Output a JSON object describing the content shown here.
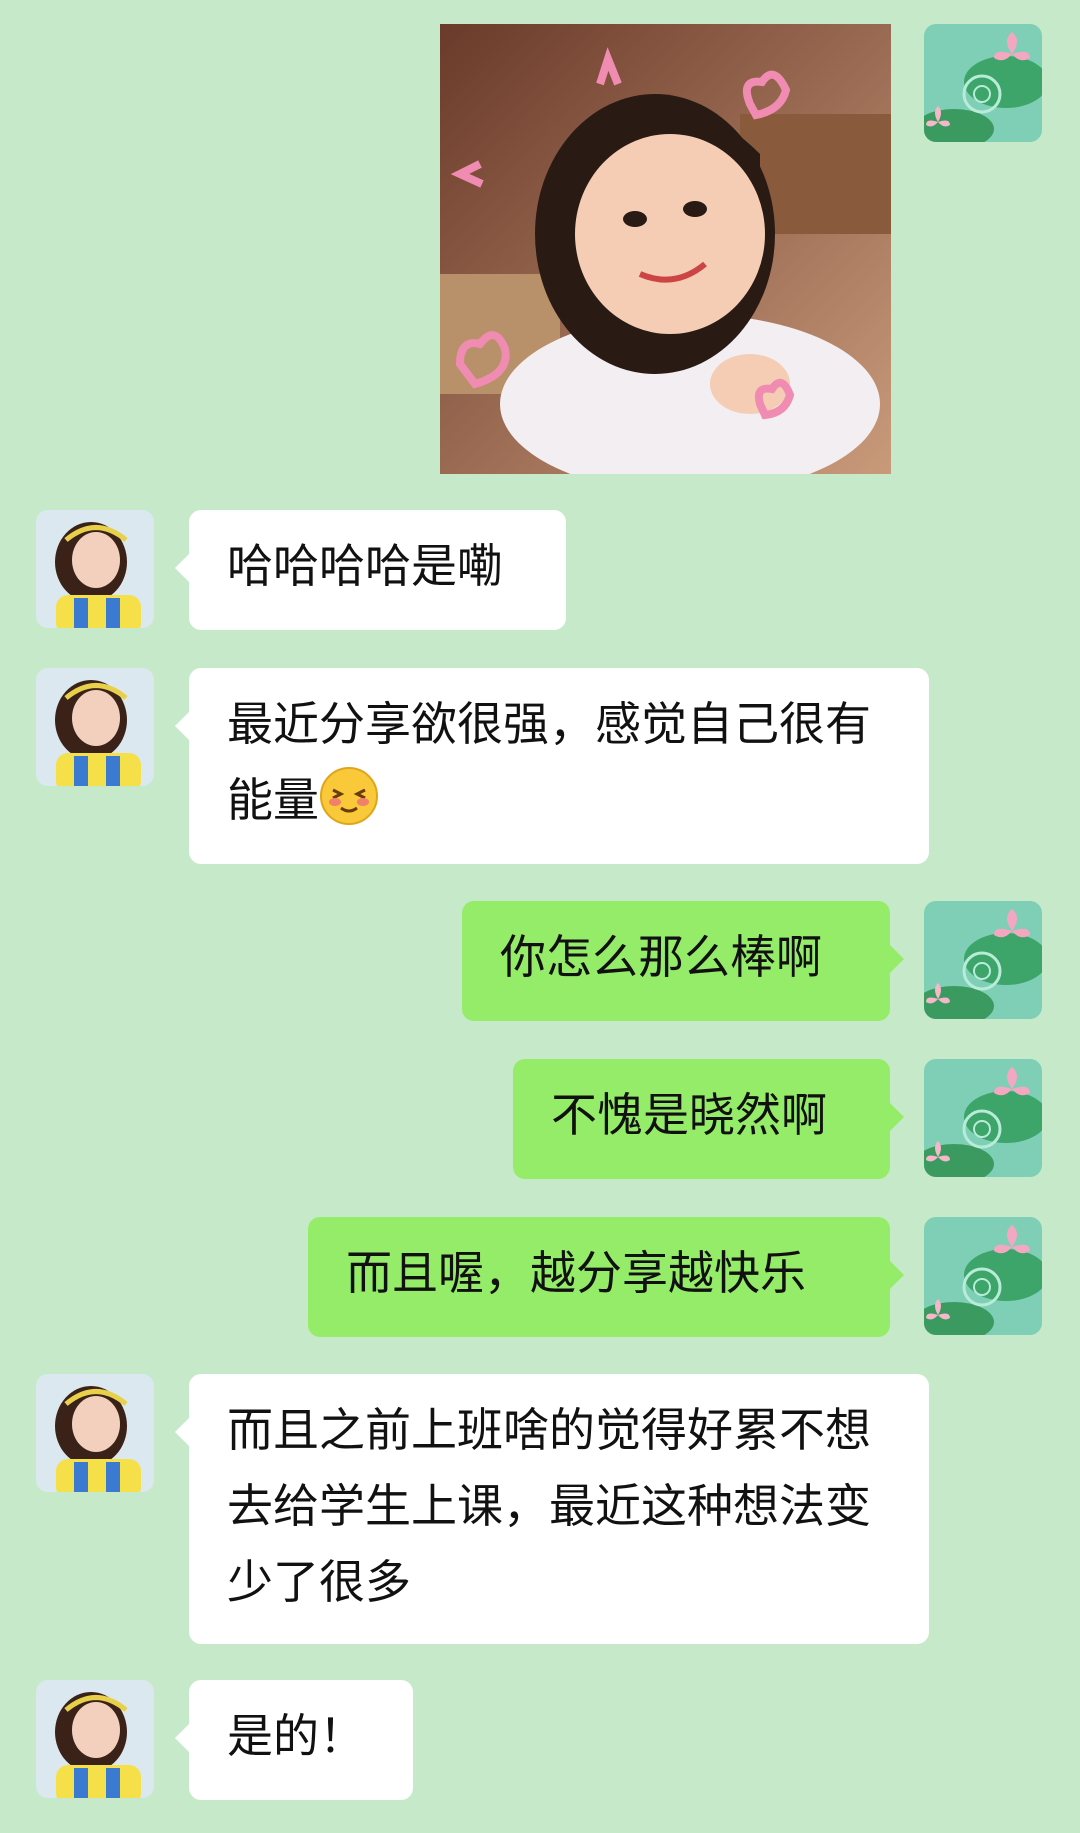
{
  "messages": [
    {
      "side": "right",
      "type": "image",
      "image_alt": "sticker-child-hearts"
    },
    {
      "side": "left",
      "type": "text",
      "text": "哈哈哈哈是嘞"
    },
    {
      "side": "left",
      "type": "text",
      "text": "最近分享欲很强，感觉自己很有能量",
      "emoji": "smiling-blush-emoji"
    },
    {
      "side": "right",
      "type": "text",
      "text": "你怎么那么棒啊"
    },
    {
      "side": "right",
      "type": "text",
      "text": "不愧是晓然啊"
    },
    {
      "side": "right",
      "type": "text",
      "text": "而且喔，越分享越快乐"
    },
    {
      "side": "left",
      "type": "text",
      "text": "而且之前上班啥的觉得好累不想去给学生上课，最近这种想法变少了很多"
    },
    {
      "side": "left",
      "type": "text",
      "text": "是的！"
    }
  ],
  "colors": {
    "background": "#c6eac9",
    "bubble_left": "#ffffff",
    "bubble_right": "#95ec69",
    "text": "#111111"
  },
  "icons": {
    "self_avatar": "lotus-pond-avatar",
    "other_avatar": "girl-yellow-shirt-avatar"
  }
}
